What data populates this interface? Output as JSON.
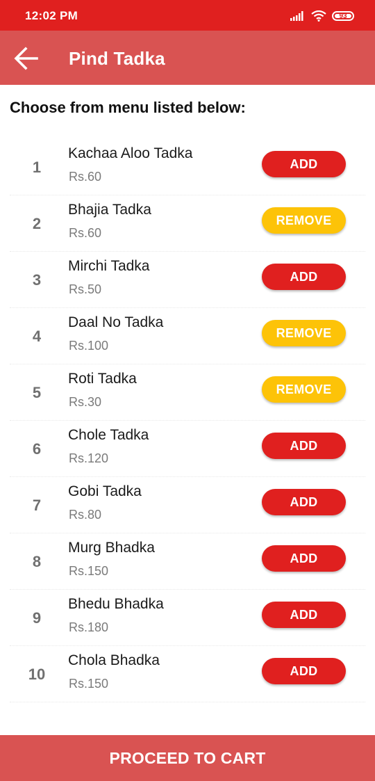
{
  "status_bar": {
    "time": "12:02 PM",
    "battery": "93",
    "icons": [
      "signal-icon",
      "wifi-icon",
      "battery-icon"
    ]
  },
  "app_bar": {
    "title": "Pind Tadka",
    "back_icon": "arrow-left-icon"
  },
  "heading": "Choose from menu listed below:",
  "colors": {
    "status_bar": "#e0201f",
    "app_bar": "#d95352",
    "add_button": "#e0201f",
    "remove_button": "#fdc308",
    "footer": "#d95352"
  },
  "menu": [
    {
      "num": "1",
      "name": "Kachaa Aloo Tadka",
      "price": "Rs.60",
      "action": "ADD"
    },
    {
      "num": "2",
      "name": "Bhajia Tadka",
      "price": "Rs.60",
      "action": "REMOVE"
    },
    {
      "num": "3",
      "name": "Mirchi Tadka",
      "price": "Rs.50",
      "action": "ADD"
    },
    {
      "num": "4",
      "name": "Daal No Tadka",
      "price": "Rs.100",
      "action": "REMOVE"
    },
    {
      "num": "5",
      "name": "Roti Tadka",
      "price": "Rs.30",
      "action": "REMOVE"
    },
    {
      "num": "6",
      "name": "Chole Tadka",
      "price": "Rs.120",
      "action": "ADD"
    },
    {
      "num": "7",
      "name": "Gobi Tadka",
      "price": "Rs.80",
      "action": "ADD"
    },
    {
      "num": "8",
      "name": "Murg Bhadka",
      "price": "Rs.150",
      "action": "ADD"
    },
    {
      "num": "9",
      "name": "Bhedu Bhadka",
      "price": "Rs.180",
      "action": "ADD"
    },
    {
      "num": "10",
      "name": "Chola Bhadka",
      "price": "Rs.150",
      "action": "ADD"
    }
  ],
  "footer": {
    "label": "PROCEED TO CART"
  }
}
